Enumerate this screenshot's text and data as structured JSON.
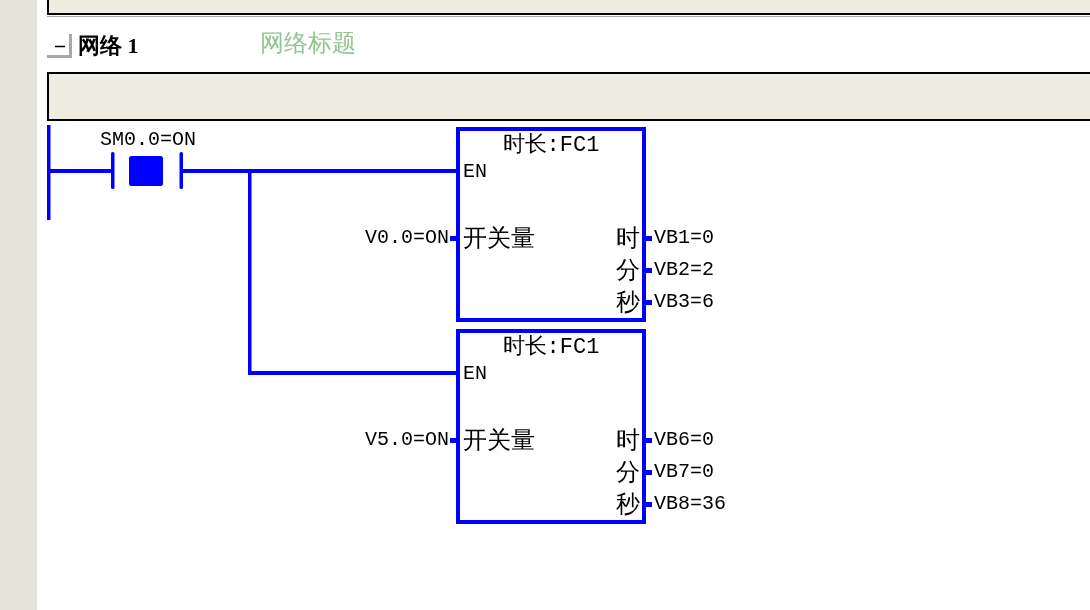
{
  "network": {
    "expanded": true,
    "label": "网络 1",
    "title_field": {
      "placeholder": "网络标题"
    }
  },
  "rung": {
    "contact": {
      "address": "SM0.0=ON",
      "on": true
    },
    "blocks": [
      {
        "title": "时长:FC1",
        "enable": "EN",
        "input": {
          "label": "开关量",
          "value": "V0.0=ON"
        },
        "outputs": [
          {
            "label": "时",
            "value": "VB1=0"
          },
          {
            "label": "分",
            "value": "VB2=2"
          },
          {
            "label": "秒",
            "value": "VB3=6"
          }
        ]
      },
      {
        "title": "时长:FC1",
        "enable": "EN",
        "input": {
          "label": "开关量",
          "value": "V5.0=ON"
        },
        "outputs": [
          {
            "label": "时",
            "value": "VB6=0"
          },
          {
            "label": "分",
            "value": "VB7=0"
          },
          {
            "label": "秒",
            "value": "VB8=36"
          }
        ]
      }
    ]
  }
}
